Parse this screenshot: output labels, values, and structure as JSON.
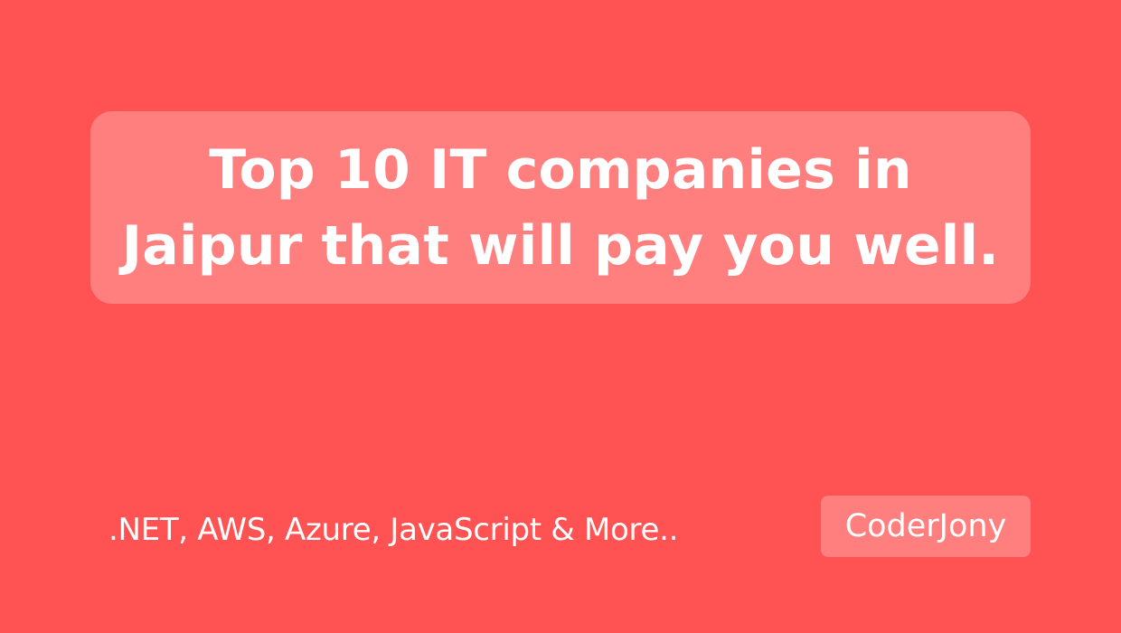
{
  "title": {
    "line1": "Top 10 IT companies in",
    "line2": "Jaipur that will pay you well."
  },
  "tagline": ".NET, AWS, Azure, JavaScript & More..",
  "brand": "CoderJony",
  "colors": {
    "background": "#ff5252",
    "box": "#ff7f7f",
    "text": "#ffffff"
  }
}
